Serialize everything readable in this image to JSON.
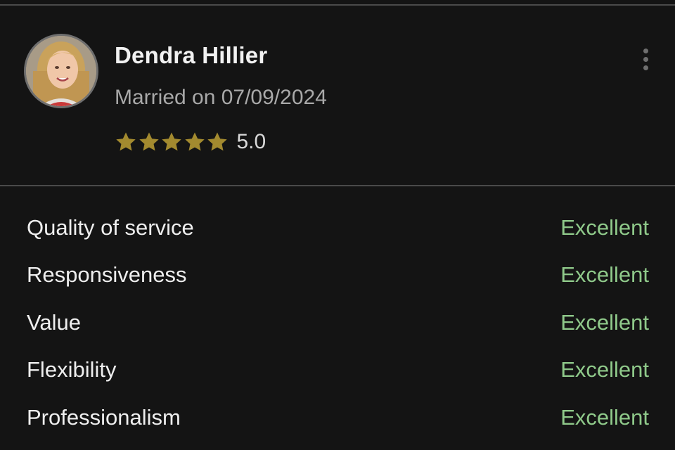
{
  "review": {
    "reviewer_name": "Dendra Hillier",
    "wedding_date": "Married on 07/09/2024",
    "rating_value": "5.0",
    "star_count": 5,
    "star_color": "#a38a2f",
    "more_icon": "vertical-ellipsis-icon"
  },
  "ratings": [
    {
      "label": "Quality of service",
      "value": "Excellent"
    },
    {
      "label": "Responsiveness",
      "value": "Excellent"
    },
    {
      "label": "Value",
      "value": "Excellent"
    },
    {
      "label": "Flexibility",
      "value": "Excellent"
    },
    {
      "label": "Professionalism",
      "value": "Excellent"
    }
  ],
  "colors": {
    "background": "#141414",
    "rating_value_text": "#8fc98a",
    "divider": "#4a4a4a"
  }
}
